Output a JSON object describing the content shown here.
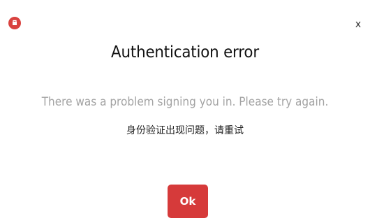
{
  "dialog": {
    "logo_icon": "app-logo-icon",
    "close_label": "x",
    "title": "Authentication error",
    "message_en": "There was a problem signing you in. Please try again.",
    "message_zh": "身份验证出现问题，请重试",
    "ok_label": "Ok"
  },
  "colors": {
    "accent": "#d63a3a",
    "secondary_text": "#a3a3a3"
  }
}
